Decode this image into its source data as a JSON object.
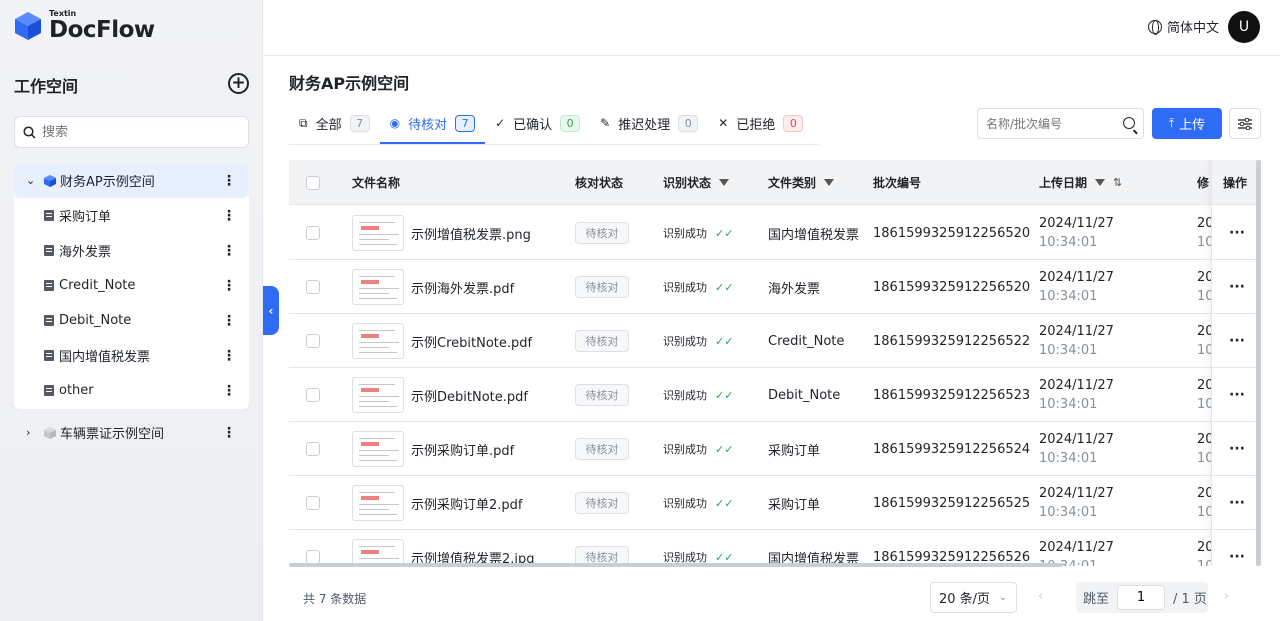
{
  "brand": {
    "small": "Textin",
    "name": "DocFlow"
  },
  "sidebar": {
    "title": "工作空间",
    "search_placeholder": "搜索",
    "workspaces": [
      {
        "name": "财务AP示例空间",
        "expanded": true,
        "docs": [
          "采购订单",
          "海外发票",
          "Credit_Note",
          "Debit_Note",
          "国内增值税发票",
          "other"
        ]
      },
      {
        "name": "车辆票证示例空间",
        "expanded": false
      }
    ]
  },
  "header": {
    "language": "简体中文",
    "avatar": "U"
  },
  "main": {
    "title": "财务AP示例空间",
    "tabs": [
      {
        "label": "全部",
        "count": "7",
        "icon": "copy-icon"
      },
      {
        "label": "待核对",
        "count": "7",
        "icon": "eye-icon",
        "active": true
      },
      {
        "label": "已确认",
        "count": "0",
        "icon": "check-icon"
      },
      {
        "label": "推迟处理",
        "count": "0",
        "icon": "pen-icon"
      },
      {
        "label": "已拒绝",
        "count": "0",
        "icon": "x-icon"
      }
    ],
    "search_placeholder": "名称/批次编号",
    "upload_label": "上传"
  },
  "table": {
    "columns": [
      "文件名称",
      "核对状态",
      "识别状态",
      "文件类别",
      "批次编号",
      "上传日期",
      "修",
      "操作"
    ],
    "rows": [
      {
        "file": "示例增值税发票.png",
        "review": "待核对",
        "recog": "识别成功",
        "category": "国内增值税发票",
        "batch": "1861599325912256520",
        "date": "2024/11/27",
        "time": "10:34:01",
        "mod_date": "20",
        "mod_time": "10:"
      },
      {
        "file": "示例海外发票.pdf",
        "review": "待核对",
        "recog": "识别成功",
        "category": "海外发票",
        "batch": "1861599325912256520",
        "date": "2024/11/27",
        "time": "10:34:01",
        "mod_date": "20",
        "mod_time": "10:"
      },
      {
        "file": "示例CrebitNote.pdf",
        "review": "待核对",
        "recog": "识别成功",
        "category": "Credit_Note",
        "batch": "1861599325912256522",
        "date": "2024/11/27",
        "time": "10:34:01",
        "mod_date": "20",
        "mod_time": "10:"
      },
      {
        "file": "示例DebitNote.pdf",
        "review": "待核对",
        "recog": "识别成功",
        "category": "Debit_Note",
        "batch": "1861599325912256523",
        "date": "2024/11/27",
        "time": "10:34:01",
        "mod_date": "20",
        "mod_time": "10:"
      },
      {
        "file": "示例采购订单.pdf",
        "review": "待核对",
        "recog": "识别成功",
        "category": "采购订单",
        "batch": "1861599325912256524",
        "date": "2024/11/27",
        "time": "10:34:01",
        "mod_date": "20",
        "mod_time": "10:"
      },
      {
        "file": "示例采购订单2.pdf",
        "review": "待核对",
        "recog": "识别成功",
        "category": "采购订单",
        "batch": "1861599325912256525",
        "date": "2024/11/27",
        "time": "10:34:01",
        "mod_date": "20",
        "mod_time": "10:"
      },
      {
        "file": "示例增值税发票2.jpg",
        "review": "待核对",
        "recog": "识别成功",
        "category": "国内增值税发票",
        "batch": "1861599325912256526",
        "date": "2024/11/27",
        "time": "10:34:01",
        "mod_date": "20",
        "mod_time": "10:"
      }
    ]
  },
  "pagination": {
    "total_text": "共 7 条数据",
    "page_size": "20 条/页",
    "jump_label": "跳至",
    "current_page": "1",
    "total_pages": "/ 1 页"
  },
  "colors": {
    "primary": "#2f6cf6",
    "success": "#30a14e",
    "danger": "#e34d4d"
  }
}
